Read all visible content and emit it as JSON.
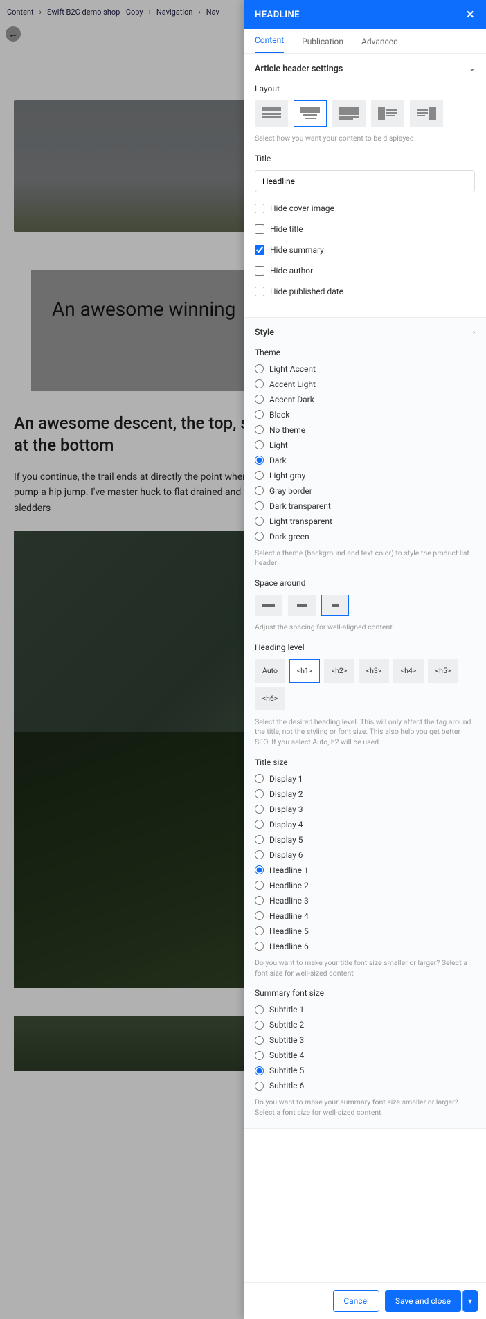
{
  "breadcrumb": [
    "Content",
    "Swift B2C demo shop - Copy",
    "Navigation",
    "Nav"
  ],
  "bg": {
    "heroTitle": "An awesome winning",
    "h2": "An awesome descent, the top, some root drops at bank turns at the bottom",
    "p": "If you continue, the trail ends at directly the point where you began the trek. This trail begins with a small pump a hip jump. I've master huck to flat drained and very good. Trail is now packed areas from where sledders"
  },
  "panel": {
    "title": "HEADLINE",
    "tabs": [
      "Content",
      "Publication",
      "Advanced"
    ],
    "accordion1": "Article header settings",
    "layoutLabel": "Layout",
    "layoutHint": "Select how you want your content to be displayed",
    "titleLabel": "Title",
    "titleValue": "Headline",
    "checks": {
      "cover": "Hide cover image",
      "title": "Hide title",
      "summary": "Hide summary",
      "author": "Hide author",
      "date": "Hide published date"
    },
    "styleLabel": "Style",
    "themeLabel": "Theme",
    "themes": [
      "Light Accent",
      "Accent Light",
      "Accent Dark",
      "Black",
      "No theme",
      "Light",
      "Dark",
      "Light gray",
      "Gray border",
      "Dark transparent",
      "Light transparent",
      "Dark green"
    ],
    "themeSelected": "Dark",
    "themeHint": "Select a theme (background and text color) to style the product list header",
    "spaceLabel": "Space around",
    "spaceHint": "Adjust the spacing for well-aligned content",
    "hlLabel": "Heading level",
    "hlOptions": [
      "Auto",
      "<h1>",
      "<h2>",
      "<h3>",
      "<h4>",
      "<h5>",
      "<h6>"
    ],
    "hlSelected": "<h1>",
    "hlHint": "Select the desired heading level. This will only affect the tag around the title, not the styling or font size. This also help you get better SEO. If you select Auto, h2 will be used.",
    "tsLabel": "Title size",
    "tsOptions": [
      "Display 1",
      "Display 2",
      "Display 3",
      "Display 4",
      "Display 5",
      "Display 6",
      "Headline 1",
      "Headline 2",
      "Headline 3",
      "Headline 4",
      "Headline 5",
      "Headline 6"
    ],
    "tsSelected": "Headline 1",
    "tsHint": "Do you want to make your title font size smaller or larger? Select a font size for well-sized content",
    "sfLabel": "Summary font size",
    "sfOptions": [
      "Subtitle 1",
      "Subtitle 2",
      "Subtitle 3",
      "Subtitle 4",
      "Subtitle 5",
      "Subtitle 6"
    ],
    "sfSelected": "Subtitle 5",
    "sfHint": "Do you want to make your summary font size smaller or larger? Select a font size for well-sized content",
    "cancel": "Cancel",
    "save": "Save and close"
  }
}
